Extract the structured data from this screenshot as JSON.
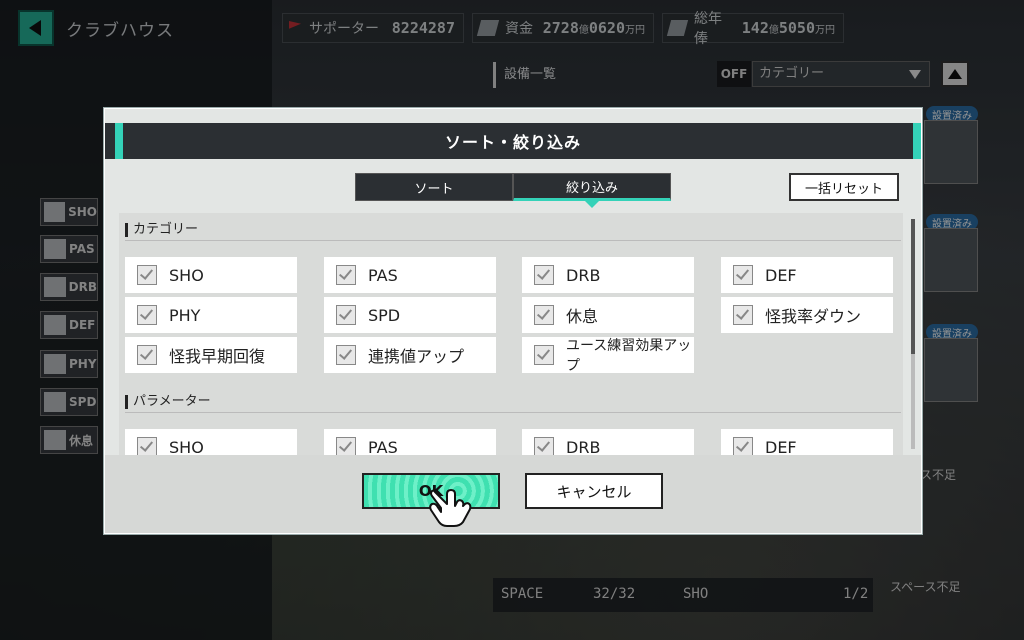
{
  "header": {
    "title": "クラブハウス",
    "supporters_label": "サポーター",
    "supporters_value": "8224287",
    "funds_label": "資金",
    "funds_value_a": "2728",
    "funds_unit_a": "億",
    "funds_value_b": "0620",
    "funds_unit_b": "万円",
    "salary_label": "総年俸",
    "salary_value_a": "142",
    "salary_unit_a": "億",
    "salary_value_b": "5050",
    "salary_unit_b": "万円"
  },
  "facility": {
    "list_label": "設備一覧",
    "off_label": "OFF",
    "category_dropdown": "カテゴリー"
  },
  "side_filters": [
    "SHO",
    "PAS",
    "DRB",
    "DEF",
    "PHY",
    "SPD",
    "休息"
  ],
  "right_cards": {
    "placed_label": "設置済み",
    "shortage_label": "ス不足"
  },
  "bottom": {
    "space_label": "SPACE",
    "space_value": "32/32",
    "sho_label": "SHO",
    "sho_value": "1/2",
    "shortage_label": "スペース不足"
  },
  "modal": {
    "title": "ソート・絞り込み",
    "tabs": [
      {
        "label": "ソート"
      },
      {
        "label": "絞り込み"
      }
    ],
    "reset_label": "一括リセット",
    "category_section": "カテゴリー",
    "category_items": [
      "SHO",
      "PAS",
      "DRB",
      "DEF",
      "PHY",
      "SPD",
      "休息",
      "怪我率ダウン",
      "怪我早期回復",
      "連携値アップ",
      "ユース練習効果アップ"
    ],
    "parameter_section": "パラメーター",
    "parameter_items": [
      "SHO",
      "PAS",
      "DRB",
      "DEF"
    ],
    "ok_label": "OK",
    "cancel_label": "キャンセル"
  },
  "colors": {
    "accent": "#34d2b8",
    "header_dark": "#2b2f33"
  }
}
